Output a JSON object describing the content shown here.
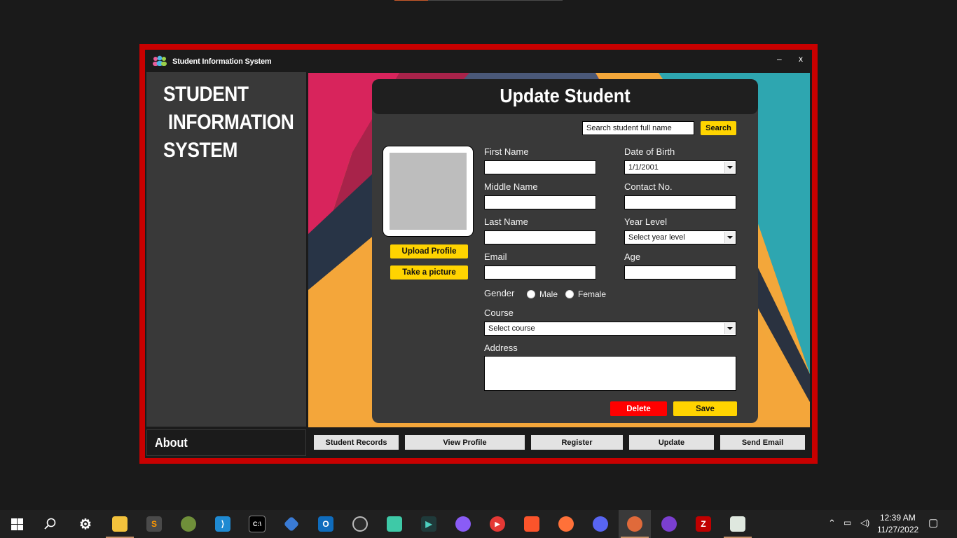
{
  "app": {
    "title": "Student Information System",
    "minimize": "–",
    "close": "x"
  },
  "sidebar": {
    "title_lines": [
      "STUDENT",
      " INFORMATION",
      "SYSTEM"
    ],
    "about_label": "About"
  },
  "form": {
    "heading": "Update Student",
    "search_placeholder": "Search student full name",
    "search_button": "Search",
    "upload_button": "Upload Profile",
    "take_picture_button": "Take a picture",
    "labels": {
      "first_name": "First Name",
      "middle_name": "Middle Name",
      "last_name": "Last Name",
      "email": "Email",
      "date_of_birth": "Date of Birth",
      "contact_no": "Contact No.",
      "year_level": "Year Level",
      "age": "Age",
      "gender": "Gender",
      "course": "Course",
      "address": "Address"
    },
    "values": {
      "first_name": "",
      "middle_name": "",
      "last_name": "",
      "email": "",
      "contact_no": "",
      "age": "",
      "address": ""
    },
    "date_of_birth_value": "1/1/2001",
    "year_level_value": "Select year level",
    "course_value": "Select course",
    "gender_options": [
      "Male",
      "Female"
    ],
    "delete_button": "Delete",
    "save_button": "Save"
  },
  "bottom_nav": [
    "Student Records",
    "View Profile",
    "Register",
    "Update",
    "Send Email"
  ],
  "taskbar": {
    "time": "12:39 AM",
    "date": "11/27/2022",
    "icons": [
      "windows-start",
      "search",
      "settings",
      "file-explorer",
      "sublime-text",
      "app-green",
      "vscode",
      "terminal",
      "git-client",
      "outlook",
      "obs-studio",
      "app-teal",
      "app-dark",
      "messenger",
      "youtube",
      "brave",
      "firefox",
      "discord",
      "app-active",
      "app-purple",
      "filezilla",
      "app-monitor"
    ]
  },
  "colors": {
    "frame_red": "#c80000",
    "accent_yellow": "#ffd400",
    "delete_red": "#ff0000",
    "panel_bg": "#393939"
  }
}
